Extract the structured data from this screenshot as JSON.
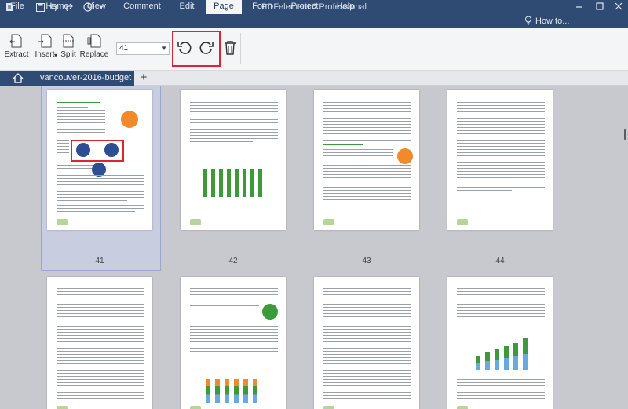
{
  "app": {
    "title": "PDFelement 6 Professional"
  },
  "quick_access": {
    "logo_icon": "app-logo-icon",
    "save_icon": "save-icon",
    "undo_icon": "undo-icon",
    "redo_icon": "redo-icon",
    "history_icon": "history-icon"
  },
  "menu": {
    "items": [
      "File",
      "Home",
      "View",
      "Comment",
      "Edit",
      "Page",
      "Form",
      "Protect",
      "Help"
    ],
    "active": "Page",
    "help_link": "How to..."
  },
  "ribbon": {
    "extract": "Extract",
    "insert": "Insert",
    "split": "Split",
    "replace": "Replace",
    "page_value": "41",
    "rotate_left_icon": "rotate-counterclockwise-icon",
    "rotate_right_icon": "rotate-clockwise-icon",
    "delete_icon": "trash-icon"
  },
  "tabs": {
    "home_icon": "home-icon",
    "document": "vancouver-2016-budget",
    "add": "+"
  },
  "pages": [
    {
      "number": "41",
      "selected": true
    },
    {
      "number": "42",
      "selected": false
    },
    {
      "number": "43",
      "selected": false
    },
    {
      "number": "44",
      "selected": false
    },
    {
      "number": "",
      "selected": false
    },
    {
      "number": "",
      "selected": false
    },
    {
      "number": "",
      "selected": false
    },
    {
      "number": "",
      "selected": false
    }
  ],
  "colors": {
    "titlebar": "#2f4a73",
    "accent_red": "#e0242b",
    "thumb_green": "#3d9a3a",
    "thumb_orange": "#f08a2a"
  }
}
